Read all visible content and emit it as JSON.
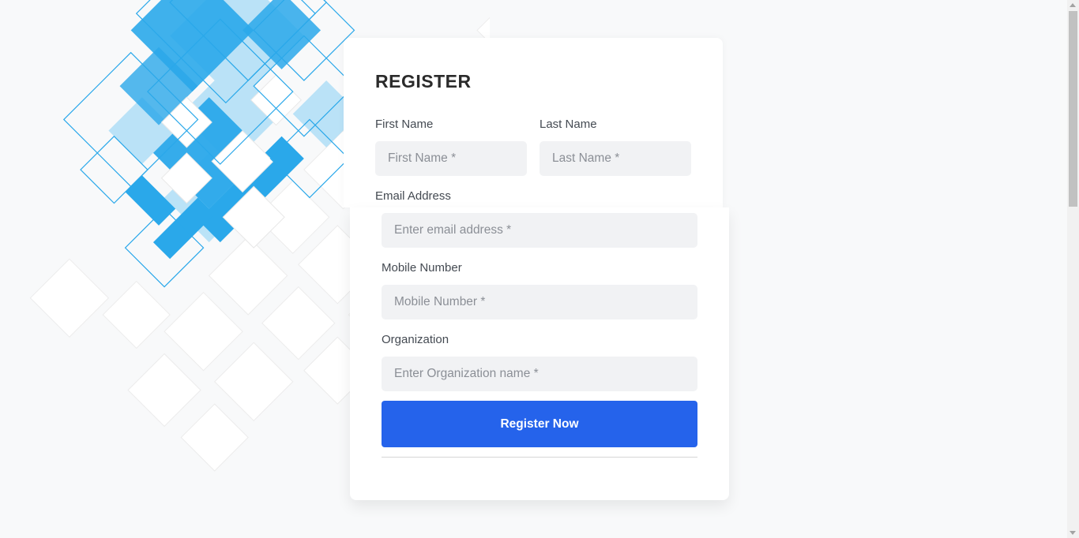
{
  "form": {
    "title": "REGISTER",
    "first_name": {
      "label": "First Name",
      "placeholder": "First Name *"
    },
    "last_name": {
      "label": "Last Name",
      "placeholder": "Last Name *"
    },
    "email": {
      "label": "Email Address",
      "placeholder": "Enter email address *"
    },
    "mobile": {
      "label": "Mobile Number",
      "placeholder": "Mobile Number *"
    },
    "organization": {
      "label": "Organization",
      "placeholder": "Enter Organization name *"
    },
    "submit_label": "Register Now"
  },
  "colors": {
    "accent": "#2563eb",
    "art_blue": "#2aa8ea",
    "art_light_blue": "#a6dbf6",
    "field_bg": "#f1f2f4",
    "page_bg": "#f8f9fa"
  }
}
